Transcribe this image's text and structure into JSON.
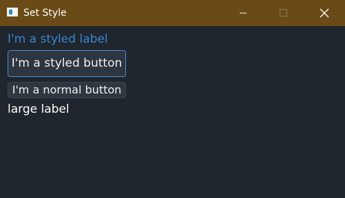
{
  "window": {
    "title": "Set Style",
    "title_bar_color": "#6a4a16",
    "background_color": "#1f262d",
    "controls": {
      "minimize_icon": "minimize-icon",
      "maximize_icon": "maximize-icon",
      "close_icon": "close-icon"
    }
  },
  "content": {
    "styled_label": "I'm a styled label",
    "styled_label_color": "#3b86d4",
    "styled_button": "I'm a styled button",
    "styled_button_border_color": "#4a8fd4",
    "normal_button": "I'm a normal button",
    "large_label": "large label"
  }
}
